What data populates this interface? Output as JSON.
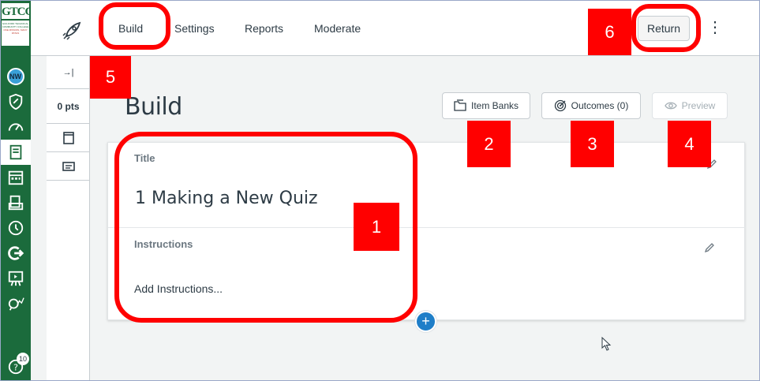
{
  "logo": {
    "text": "GTCC",
    "sub": "GUILFORD TECHNICAL COMMUNITY COLLEGE",
    "tag": "ONE MISSION, MANY PATHS"
  },
  "global_nav": {
    "avatar_initials": "NW",
    "help_badge": "10",
    "items": [
      "account-avatar",
      "admin-shield",
      "dashboard",
      "courses",
      "calendar",
      "inbox",
      "history",
      "commons",
      "studio",
      "analytics",
      "help"
    ]
  },
  "tabs": {
    "build": "Build",
    "settings": "Settings",
    "reports": "Reports",
    "moderate": "Moderate"
  },
  "header": {
    "return_label": "Return",
    "kebab": "⋮"
  },
  "sidebar": {
    "collapse": "→|",
    "points": "0 pts"
  },
  "main": {
    "title": "Build",
    "item_banks": "Item Banks",
    "outcomes": "Outcomes (0)",
    "preview": "Preview"
  },
  "card": {
    "title_label": "Title",
    "quiz_title": "1 Making a New Quiz",
    "instructions_label": "Instructions",
    "instructions_placeholder": "Add Instructions..."
  },
  "annotations": [
    "1",
    "2",
    "3",
    "4",
    "5",
    "6"
  ],
  "colors": {
    "nav_green": "#1b6b3c",
    "annotation_red": "#ff0000",
    "accent_blue": "#1e7ec8"
  }
}
